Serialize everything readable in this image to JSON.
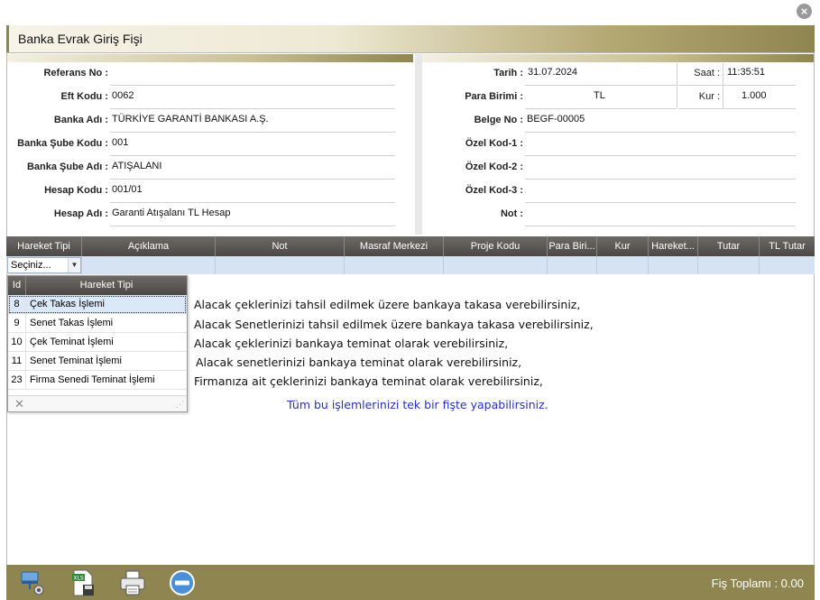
{
  "window": {
    "title": "Banka Evrak Giriş Fişi"
  },
  "left_fields": [
    {
      "label": "Referans No :",
      "value": ""
    },
    {
      "label": "Eft Kodu :",
      "value": "0062"
    },
    {
      "label": "Banka Adı :",
      "value": "TÜRKİYE GARANTİ BANKASI A.Ş."
    },
    {
      "label": "Banka Şube Kodu :",
      "value": "001"
    },
    {
      "label": "Banka Şube Adı :",
      "value": "ATIŞALANI"
    },
    {
      "label": "Hesap Kodu :",
      "value": "001/01"
    },
    {
      "label": "Hesap Adı :",
      "value": "Garanti Atışalanı TL Hesap"
    }
  ],
  "right_fields": {
    "tarih": {
      "label": "Tarih :",
      "value": "31.07.2024"
    },
    "saat": {
      "label": "Saat :",
      "value": "11:35:51"
    },
    "para_birimi": {
      "label": "Para Birimi :",
      "value": "TL"
    },
    "kur": {
      "label": "Kur :",
      "value": "1.000"
    },
    "belge_no": {
      "label": "Belge No :",
      "value": "BEGF-00005"
    },
    "ozel_kod_1": {
      "label": "Özel Kod-1 :",
      "value": ""
    },
    "ozel_kod_2": {
      "label": "Özel Kod-2 :",
      "value": ""
    },
    "ozel_kod_3": {
      "label": "Özel Kod-3 :",
      "value": ""
    },
    "not": {
      "label": "Not :",
      "value": ""
    }
  },
  "grid": {
    "columns": [
      "Hareket Tipi",
      "Açıklama",
      "Not",
      "Masraf Merkezi",
      "Proje Kodu",
      "Para Biri...",
      "Kur",
      "Hareket...",
      "Tutar",
      "TL Tutar"
    ],
    "combo_value": "Seçiniz..."
  },
  "dropdown": {
    "headers": {
      "id": "Id",
      "name": "Hareket Tipi"
    },
    "rows": [
      {
        "id": "8",
        "name": "Çek Takas İşlemi"
      },
      {
        "id": "9",
        "name": "Senet Takas İşlemi"
      },
      {
        "id": "10",
        "name": "Çek Teminat İşlemi"
      },
      {
        "id": "11",
        "name": "Senet Teminat İşlemi"
      },
      {
        "id": "23",
        "name": "Firma Senedi Teminat İşlemi"
      }
    ],
    "selected_id": "8"
  },
  "info_lines": [
    "Alacak çeklerinizi tahsil edilmek üzere bankaya takasa verebilirsiniz,",
    "Alacak Senetlerinizi tahsil edilmek üzere bankaya takasa verebilirsiniz,",
    "Alacak çeklerinizi bankaya teminat olarak verebilirsiniz,",
    "Alacak senetlerinizi bankaya teminat olarak verebilirsiniz,",
    "Firmanıza ait çeklerinizi bankaya teminat olarak verebilirsiniz,"
  ],
  "info_highlight": "Tüm bu işlemlerinizi tek bir fişte yapabilirsiniz.",
  "footer": {
    "total": "Fiş Toplamı : 0.00"
  },
  "colors": {
    "accent": "#8f8550",
    "grid_header": "#4b4845",
    "grid_row": "#d5e3f2",
    "highlight_text": "#2233bb"
  }
}
